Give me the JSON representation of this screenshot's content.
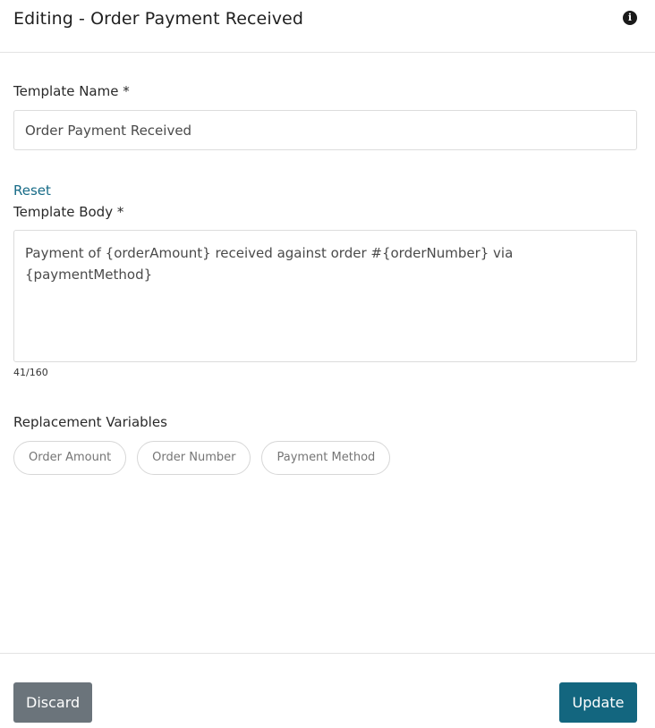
{
  "header": {
    "title": "Editing - Order Payment Received",
    "info_icon": "info-icon"
  },
  "form": {
    "template_name": {
      "label": "Template Name *",
      "value": "Order Payment Received"
    },
    "reset_label": "Reset",
    "template_body": {
      "label": "Template Body *",
      "value": "Payment of {orderAmount} received against order #{orderNumber} via {paymentMethod}",
      "counter": "41/160"
    },
    "replacement_variables": {
      "label": "Replacement Variables",
      "chips": [
        "Order Amount",
        "Order Number",
        "Payment Method"
      ]
    }
  },
  "footer": {
    "discard_label": "Discard",
    "update_label": "Update"
  },
  "colors": {
    "accent": "#13667f",
    "link": "#176b87",
    "discard": "#6b747b"
  }
}
